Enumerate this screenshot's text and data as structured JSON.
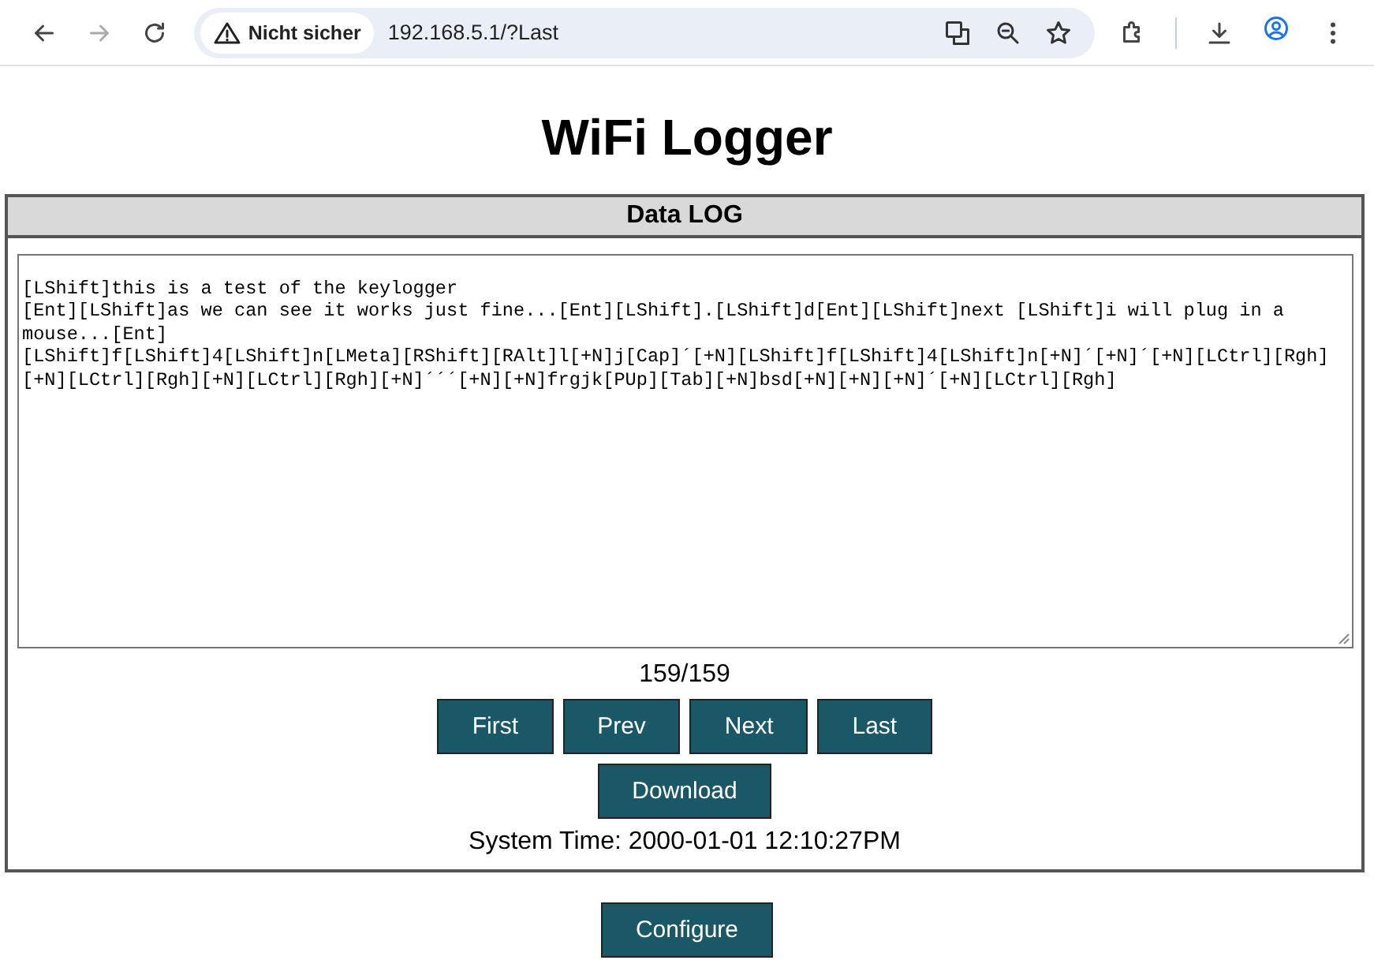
{
  "browser": {
    "back_disabled": false,
    "forward_disabled": true,
    "security_label": "Nicht sicher",
    "url": "192.168.5.1/?Last"
  },
  "page": {
    "title": "WiFi Logger"
  },
  "log_panel": {
    "heading": "Data LOG",
    "log_text": "[LShift]this is a test of the keylogger\n[Ent][LShift]as we can see it works just fine...[Ent][LShift].[LShift]d[Ent][LShift]next [LShift]i will plug in a mouse...[Ent]\n[LShift]f[LShift]4[LShift]n[LMeta][RShift][RAlt]l[+N]j[Cap]´[+N][LShift]f[LShift]4[LShift]n[+N]´[+N]´[+N][LCtrl][Rgh][+N][LCtrl][Rgh][+N][LCtrl][Rgh][+N]´´´[+N][+N]frgjk[PUp][Tab][+N]bsd[+N][+N][+N]´[+N][LCtrl][Rgh]",
    "counter": "159/159",
    "nav_buttons": [
      "First",
      "Prev",
      "Next",
      "Last"
    ],
    "download_button": "Download",
    "system_time": "System Time: 2000-01-01 12:10:27PM"
  },
  "configure_button": "Configure"
}
